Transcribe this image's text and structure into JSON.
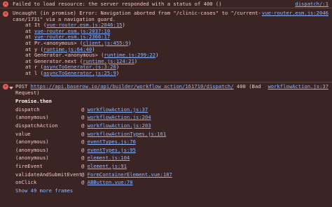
{
  "colors": {
    "background": "#3b2424",
    "text": "#f3c6c6",
    "link": "#8fb7ff",
    "error_icon": "#e35d5d",
    "divider": "#6a3b3b"
  },
  "message1": {
    "icon": "error-icon",
    "text": "Failed to load resource: the server responded with a status of 400 ()",
    "source": "dispatch/:1"
  },
  "message2": {
    "icon": "error-icon",
    "text": "Uncaught (in promise) Error: Navigation aborted from \"/clinic-cases\" to \"/current-case/1731\" via a navigation guard.",
    "source": "vue-router.esm.js:2046",
    "stack": [
      {
        "prefix": "at It (",
        "link": "vue-router.esm.js:2046:15",
        "suffix": ")"
      },
      {
        "prefix": "at ",
        "link": "vue-router.esm.js:2037:10",
        "suffix": ""
      },
      {
        "prefix": "at ",
        "link": "vue-router.esm.js:2366:17",
        "suffix": ""
      },
      {
        "prefix": "at Pr.<anonymous> (",
        "link": "client.js:455:9",
        "suffix": ")"
      },
      {
        "prefix": "at y (",
        "link": "runtime.js:64:40",
        "suffix": ")"
      },
      {
        "prefix": "at Generator.<anonymous> (",
        "link": "runtime.js:299:22",
        "suffix": ")"
      },
      {
        "prefix": "at Generator.next (",
        "link": "runtime.js:124:21",
        "suffix": ")"
      },
      {
        "prefix": "at r (",
        "link": "asyncToGenerator.js:3:20",
        "suffix": ")"
      },
      {
        "prefix": "at l (",
        "link": "asyncToGenerator.js:25:9",
        "suffix": ")"
      }
    ]
  },
  "message3": {
    "icon": "error-icon",
    "method": "POST",
    "url": "https://api.baserow.io/api/builder/workflow_action/161710/dispatch/",
    "status": "400 (Bad Request)",
    "source": "workflowAction.js:37",
    "frames_title": "Promise.then",
    "frames": [
      {
        "fn": "dispatch",
        "link": "workflowAction.js:37"
      },
      {
        "fn": "(anonymous)",
        "link": "workflowAction.js:204"
      },
      {
        "fn": "dispatchAction",
        "link": "workflowAction.js:203"
      },
      {
        "fn": "value",
        "link": "workflowActionTypes.js:161"
      },
      {
        "fn": "(anonymous)",
        "link": "eventTypes.js:76"
      },
      {
        "fn": "(anonymous)",
        "link": "eventTypes.js:95"
      },
      {
        "fn": "(anonymous)",
        "link": "element.js:104"
      },
      {
        "fn": "fireEvent",
        "link": "element.js:91"
      },
      {
        "fn": "validateAndSubmitEvent",
        "link": "FormContainerElement.vue:187"
      },
      {
        "fn": "onClick",
        "link": "ABButton.vue:70"
      }
    ],
    "show_more": "Show 49 more frames"
  }
}
